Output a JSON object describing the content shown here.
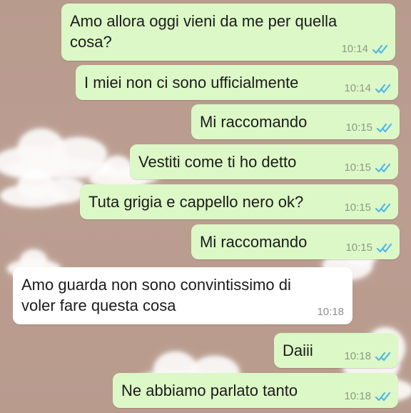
{
  "chat": {
    "messages": [
      {
        "direction": "sent",
        "text": "Amo allora oggi vieni da me per quella cosa?",
        "time": "10:14",
        "status": "read",
        "ticks_icon": "double-check-icon"
      },
      {
        "direction": "sent",
        "text": "I miei non ci sono ufficialmente",
        "time": "10:14",
        "status": "read",
        "ticks_icon": "double-check-icon"
      },
      {
        "direction": "sent",
        "text": "Mi raccomando",
        "time": "10:15",
        "status": "read",
        "ticks_icon": "double-check-icon"
      },
      {
        "direction": "sent",
        "text": "Vestiti come ti ho detto",
        "time": "10:15",
        "status": "read",
        "ticks_icon": "double-check-icon"
      },
      {
        "direction": "sent",
        "text": "Tuta grigia e cappello nero ok?",
        "time": "10:15",
        "status": "read",
        "ticks_icon": "double-check-icon"
      },
      {
        "direction": "sent",
        "text": "Mi raccomando",
        "time": "10:15",
        "status": "read",
        "ticks_icon": "double-check-icon"
      },
      {
        "direction": "received",
        "text": "Amo guarda non sono convintissimo di voler fare questa cosa",
        "time": "10:18"
      },
      {
        "direction": "sent",
        "text": "Daiii",
        "time": "10:18",
        "status": "read",
        "ticks_icon": "double-check-icon"
      },
      {
        "direction": "sent",
        "text": "Ne abbiamo parlato tanto",
        "time": "10:18",
        "status": "read",
        "ticks_icon": "double-check-icon"
      }
    ]
  },
  "theme": {
    "background": "#b99c8f",
    "sent_bubble": "#dcf8c6",
    "received_bubble": "#ffffff",
    "read_tick": "#4fb6ec"
  }
}
